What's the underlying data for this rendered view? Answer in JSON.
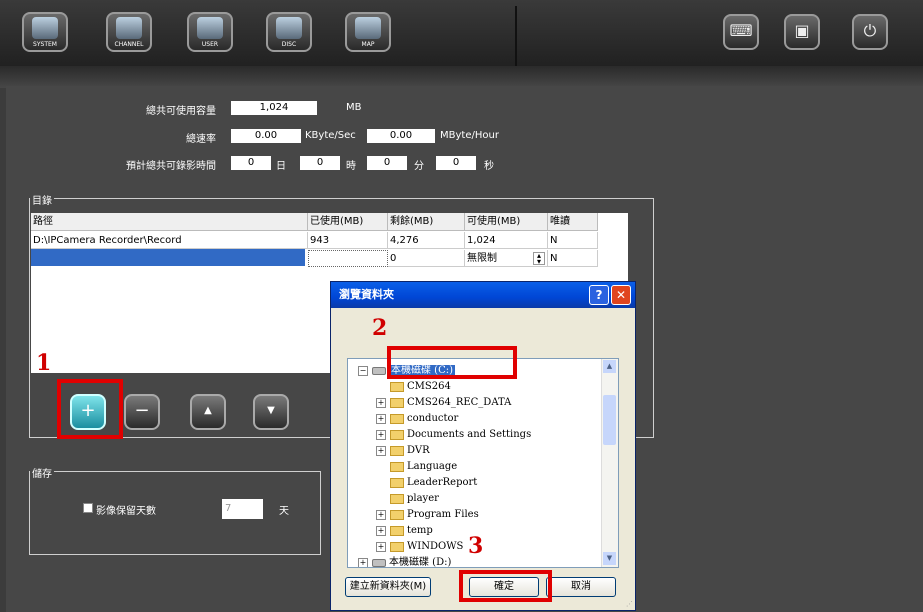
{
  "toolbar": {
    "buttons": [
      {
        "label": "SYSTEM",
        "icon": "monitor-icon"
      },
      {
        "label": "CHANNEL",
        "icon": "camera-icon"
      },
      {
        "label": "USER",
        "icon": "user-icon"
      },
      {
        "label": "DISC",
        "icon": "disc-icon"
      },
      {
        "label": "MAP",
        "icon": "map-icon"
      }
    ],
    "right_buttons": [
      {
        "icon": "keyboard-icon",
        "glyph": "⌨"
      },
      {
        "icon": "save-icon",
        "glyph": "▣"
      },
      {
        "icon": "power-icon",
        "glyph": "⏻"
      }
    ]
  },
  "capacity": {
    "total_label": "總共可使用容量",
    "total_value": "1,024",
    "total_unit": "MB",
    "rate_label": "總速率",
    "rate_kb_value": "0.00",
    "rate_kb_unit": "KByte/Sec",
    "rate_mb_value": "0.00",
    "rate_mb_unit": "MByte/Hour",
    "time_label": "預計總共可錄影時間",
    "day_value": "0",
    "day_unit": "日",
    "hour_value": "0",
    "hour_unit": "時",
    "min_value": "0",
    "min_unit": "分",
    "sec_value": "0",
    "sec_unit": "秒"
  },
  "directory": {
    "group_label": "目錄",
    "columns": [
      "路徑",
      "已使用(MB)",
      "剩餘(MB)",
      "可使用(MB)",
      "唯讀"
    ],
    "rows": [
      [
        "D:\\IPCamera Recorder\\Record",
        "943",
        "4,276",
        "1,024",
        "N"
      ],
      [
        "",
        "",
        "0",
        "無限制",
        "N"
      ]
    ]
  },
  "storage": {
    "group_label": "儲存",
    "keep_days_label": "影像保留天數",
    "keep_days_value": "7",
    "keep_days_unit": "天"
  },
  "annotations": {
    "step1": "1",
    "step2": "2",
    "step3": "3",
    "accent": "#e00000"
  },
  "dialog": {
    "title": "瀏覽資料夾",
    "help_label": "?",
    "close_label": "✕",
    "tree": [
      {
        "label": "本機磁碟 (C:)",
        "type": "disk",
        "expand": "−",
        "indent": 0,
        "selected": true
      },
      {
        "label": "CMS264",
        "type": "folder",
        "expand": "",
        "indent": 1
      },
      {
        "label": "CMS264_REC_DATA",
        "type": "folder",
        "expand": "+",
        "indent": 1
      },
      {
        "label": "conductor",
        "type": "folder",
        "expand": "+",
        "indent": 1
      },
      {
        "label": "Documents and Settings",
        "type": "folder",
        "expand": "+",
        "indent": 1
      },
      {
        "label": "DVR",
        "type": "folder",
        "expand": "+",
        "indent": 1
      },
      {
        "label": "Language",
        "type": "folder",
        "expand": "",
        "indent": 1
      },
      {
        "label": "LeaderReport",
        "type": "folder",
        "expand": "",
        "indent": 1
      },
      {
        "label": "player",
        "type": "folder",
        "expand": "",
        "indent": 1
      },
      {
        "label": "Program Files",
        "type": "folder",
        "expand": "+",
        "indent": 1
      },
      {
        "label": "temp",
        "type": "folder",
        "expand": "+",
        "indent": 1
      },
      {
        "label": "WINDOWS",
        "type": "folder",
        "expand": "+",
        "indent": 1
      },
      {
        "label": "本機磁碟 (D:)",
        "type": "disk",
        "expand": "+",
        "indent": 0
      }
    ],
    "new_folder_label": "建立新資料夾(M)",
    "ok_label": "確定",
    "cancel_label": "取消"
  }
}
